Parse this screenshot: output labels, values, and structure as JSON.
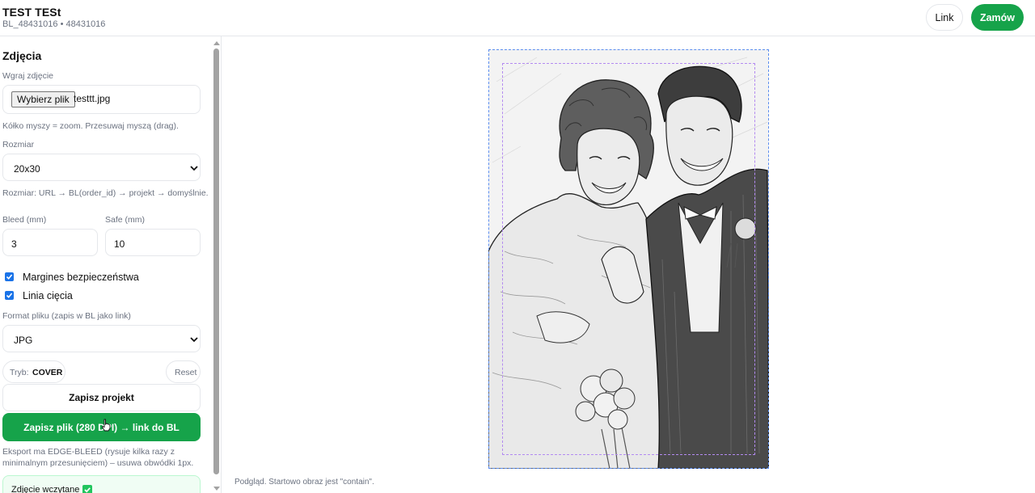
{
  "header": {
    "title": "TEST TESt",
    "subtitle": "BL_48431016 • 48431016",
    "link_label": "Link",
    "order_label": "Zamów"
  },
  "sidebar": {
    "section_title": "Zdjęcia",
    "upload": {
      "label": "Wgraj zdjęcie",
      "button_label": "Wybierz plik",
      "file_name": "testtt.jpg",
      "hint": "Kółko myszy = zoom. Przesuwaj myszą (drag)."
    },
    "size": {
      "label": "Rozmiar",
      "value": "20x30",
      "hint": "Rozmiar: URL → BL(order_id) → projekt → domyślnie."
    },
    "bleed": {
      "label": "Bleed (mm)",
      "value": "3"
    },
    "safe": {
      "label": "Safe (mm)",
      "value": "10"
    },
    "checkboxes": [
      {
        "label": "Margines bezpieczeństwa",
        "checked": true
      },
      {
        "label": "Linia cięcia",
        "checked": true
      }
    ],
    "format": {
      "label": "Format pliku (zapis w BL jako link)",
      "value": "JPG"
    },
    "mode": {
      "key": "Tryb:",
      "value": "COVER"
    },
    "reset_label": "Reset",
    "save_project_label": "Zapisz projekt",
    "save_file_label": "Zapisz plik (280 DPI) → link do BL",
    "export_hint": "Eksport ma EDGE-BLEED (rysuje kilka razy z minimalnym przesunięciem) – usuwa obwódki 1px.",
    "status_text": "Zdjęcie wczytane"
  },
  "preview": {
    "note": "Podgląd. Startowo obraz jest \"contain\"."
  },
  "colors": {
    "accent_green": "#16a34a",
    "bleed_line": "#5b8def",
    "safe_line": "#b38af0",
    "checkbox_blue": "#1a73e8"
  },
  "icons": [
    "chevron-down-icon",
    "check-icon",
    "scroll-up-icon",
    "scroll-down-icon",
    "pointer-cursor-icon"
  ]
}
